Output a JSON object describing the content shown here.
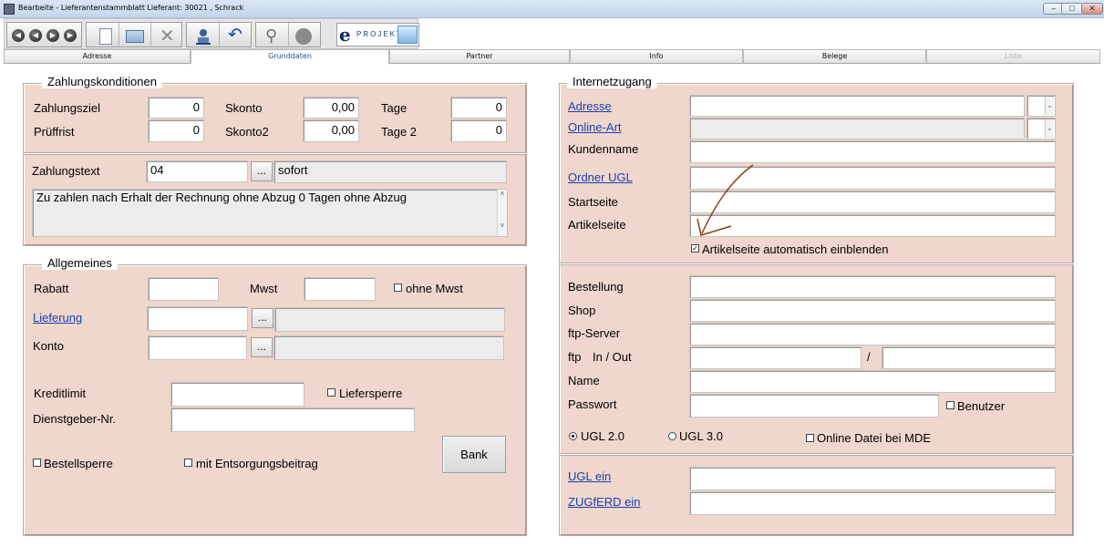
{
  "window": {
    "title": "Bearbeite - Lieferantenstammblatt Lieferant:     30021 , Schrack",
    "minimize": "–",
    "restore": "□",
    "close": "✕"
  },
  "toolbar": {
    "nav": [
      "◀",
      "◀",
      "▶",
      "▶"
    ],
    "eprojekt_label": "PROJEKT:",
    "eprojekt_letter": "e"
  },
  "tabs": [
    {
      "label": "Adresse"
    },
    {
      "label": "Grunddaten"
    },
    {
      "label": "Partner"
    },
    {
      "label": "Info"
    },
    {
      "label": "Belege"
    },
    {
      "label": "Liste"
    }
  ],
  "zahlungskonditionen": {
    "title": "Zahlungskonditionen",
    "zahlungsziel_label": "Zahlungsziel",
    "zahlungsziel_value": "0",
    "skonto_label": "Skonto",
    "skonto_value": "0,00",
    "tage_label": "Tage",
    "tage_value": "0",
    "pruefrist_label": "Prüffrist",
    "pruefrist_value": "0",
    "skonto2_label": "Skonto2",
    "skonto2_value": "0,00",
    "tage2_label": "Tage 2",
    "tage2_value": "0",
    "zahlungstext_label": "Zahlungstext",
    "zahlungstext_code": "04",
    "dots": "...",
    "zahlungstext_desc": "sofort",
    "zahlungstext_full": "Zu zahlen nach Erhalt der Rechnung ohne Abzug 0 Tagen ohne Abzug"
  },
  "allgemeines": {
    "title": "Allgemeines",
    "rabatt_label": "Rabatt",
    "mwst_label": "Mwst",
    "ohne_mwst_label": "ohne Mwst",
    "lieferung_label": "Lieferung",
    "konto_label": "Konto",
    "dots": "...",
    "kreditlimit_label": "Kreditlimit",
    "liefersperre_label": "Liefersperre",
    "dienstgeber_label": "Dienstgeber-Nr.",
    "bestellsperre_label": "Bestellsperre",
    "entsorgung_label": "mit Entsorgungsbeitrag",
    "bank_button": "Bank"
  },
  "internetzugang": {
    "title": "Internetzugang",
    "adresse_label": "Adresse",
    "online_art_label": "Online-Art",
    "kundenname_label": "Kundenname",
    "ordner_ugl_label": "Ordner UGL",
    "startseite_label": "Startseite",
    "artikelseite_label": "Artikelseite",
    "artikelseite_auto_label": "Artikelseite automatisch einblenden",
    "artikelseite_auto_checked": "✓",
    "bestellung_label": "Bestellung",
    "shop_label": "Shop",
    "ftp_server_label": "ftp-Server",
    "ftp_label": "ftp",
    "in_out_label": "In / Out",
    "slash": "/",
    "name_label": "Name",
    "passwort_label": "Passwort",
    "benutzer_label": "Benutzer",
    "ugl20_label": "UGL 2.0",
    "ugl30_label": "UGL 3.0",
    "online_datei_label": "Online Datei bei MDE",
    "ugl_ein_label": "UGL ein",
    "zugferd_label": "ZUGfERD ein"
  }
}
